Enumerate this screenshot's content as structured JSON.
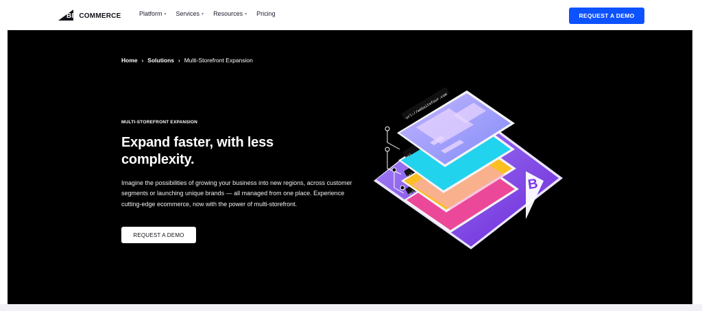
{
  "nav": {
    "logo_big": "BIG",
    "logo_rest": "COMMERCE",
    "items": [
      {
        "label": "Platform",
        "has_menu": true
      },
      {
        "label": "Services",
        "has_menu": true
      },
      {
        "label": "Resources",
        "has_menu": true
      },
      {
        "label": "Pricing",
        "has_menu": false
      }
    ],
    "cta_label": "REQUEST A DEMO"
  },
  "breadcrumb": {
    "items": [
      "Home",
      "Solutions",
      "Multi-Storefront Expansion"
    ]
  },
  "hero": {
    "eyebrow": "MULTI-STOREFRONT EXPANSION",
    "title": "Expand faster, with less complexity.",
    "description": "Imagine the possibilities of growing your business into new regions, across customer segments or launching unique brands — all managed from one place. Experience cutting-edge ecommerce, now with the power of multi-storefront.",
    "cta_label": "REQUEST A DEMO"
  },
  "illustration": {
    "url_label": "url://websitefour.com",
    "url_stub": "url",
    "brand_letter": "B"
  },
  "colors": {
    "primary": "#0d52ff",
    "hero_bg": "#000000",
    "purple": "#8b5cf6",
    "cyan": "#22d3ee",
    "orange": "#fbbf24",
    "pink": "#ec4899"
  }
}
